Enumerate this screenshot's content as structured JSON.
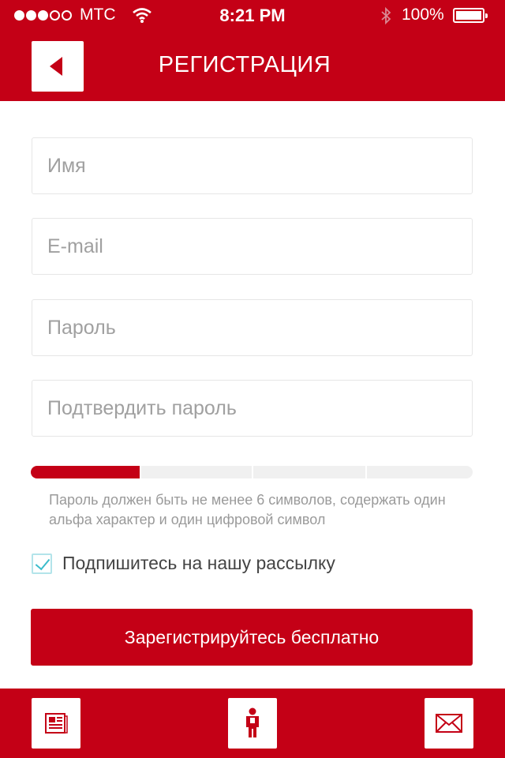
{
  "status_bar": {
    "carrier": "МТС",
    "time": "8:21 PM",
    "battery": "100%"
  },
  "header": {
    "title": "РЕГИСТРАЦИЯ",
    "back_icon": "back-arrow-icon"
  },
  "form": {
    "name_placeholder": "Имя",
    "email_placeholder": "E-mail",
    "password_placeholder": "Пароль",
    "confirm_placeholder": "Подтвердить пароль",
    "strength_level": 0.25,
    "password_hint": "Пароль должен быть не менее 6 символов, содержать один альфа характер и один цифровой символ",
    "subscribe_label": "Подпишитесь на нашу рассылку",
    "subscribe_checked": true,
    "submit_label": "Зарегистрируйтесь бесплатно"
  },
  "footer": {
    "icons": [
      "news-icon",
      "person-icon",
      "mail-icon"
    ]
  },
  "colors": {
    "brand_red": "#c40016",
    "checkbox_accent": "#3bbccb"
  }
}
